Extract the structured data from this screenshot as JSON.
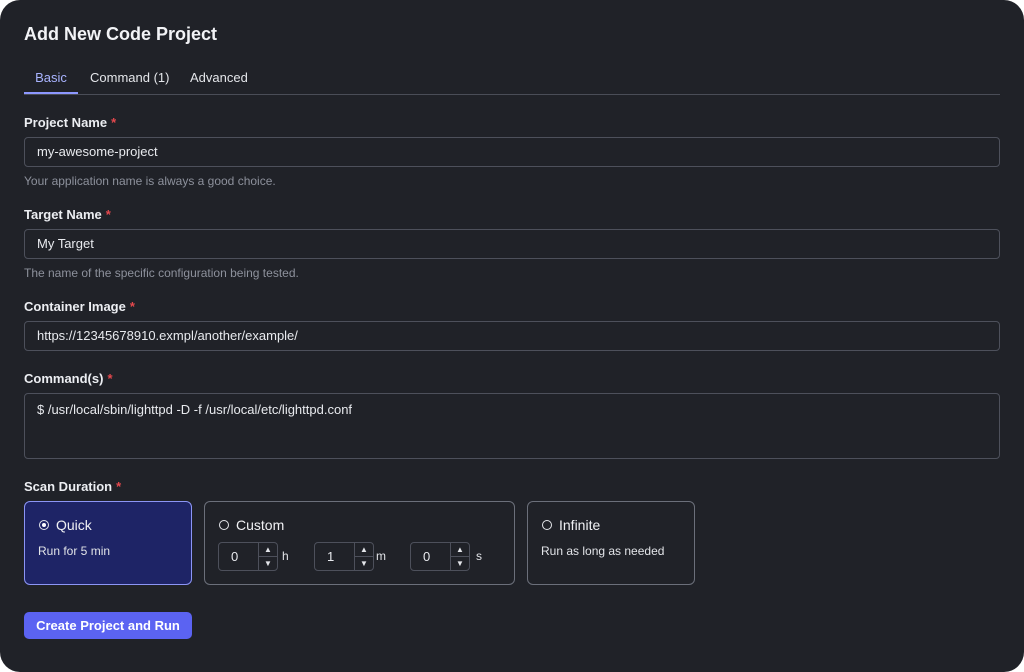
{
  "dialog": {
    "title": "Add New Code Project",
    "tabs": [
      {
        "label": "Basic",
        "active": true
      },
      {
        "label": "Command (1)",
        "active": false
      },
      {
        "label": "Advanced",
        "active": false
      }
    ]
  },
  "form": {
    "project_name": {
      "label": "Project Name",
      "required_mark": "*",
      "value": "my-awesome-project",
      "help": "Your application name is always a good choice."
    },
    "target_name": {
      "label": "Target Name",
      "required_mark": "*",
      "value": "My Target",
      "help": "The name of the specific configuration being tested."
    },
    "container_image": {
      "label": "Container Image",
      "required_mark": "*",
      "value": "https://12345678910.exmpl/another/example/"
    },
    "commands": {
      "label": "Command(s)",
      "required_mark": "*",
      "value": "$ /usr/local/sbin/lighttpd -D -f /usr/local/etc/lighttpd.conf"
    },
    "scan_duration": {
      "label": "Scan Duration",
      "required_mark": "*",
      "options": {
        "quick": {
          "title": "Quick",
          "desc": "Run for 5 min",
          "selected": true
        },
        "custom": {
          "title": "Custom",
          "selected": false,
          "hours": {
            "value": "0",
            "unit": "h"
          },
          "minutes": {
            "value": "1",
            "unit": "m"
          },
          "seconds": {
            "value": "0",
            "unit": "s"
          }
        },
        "infinite": {
          "title": "Infinite",
          "desc": "Run as long as needed",
          "selected": false
        }
      }
    }
  },
  "actions": {
    "submit_label": "Create Project and Run"
  },
  "colors": {
    "background": "#202228",
    "accent": "#5b63f2",
    "selected_card": "#1e2466",
    "required": "#e5484d"
  }
}
